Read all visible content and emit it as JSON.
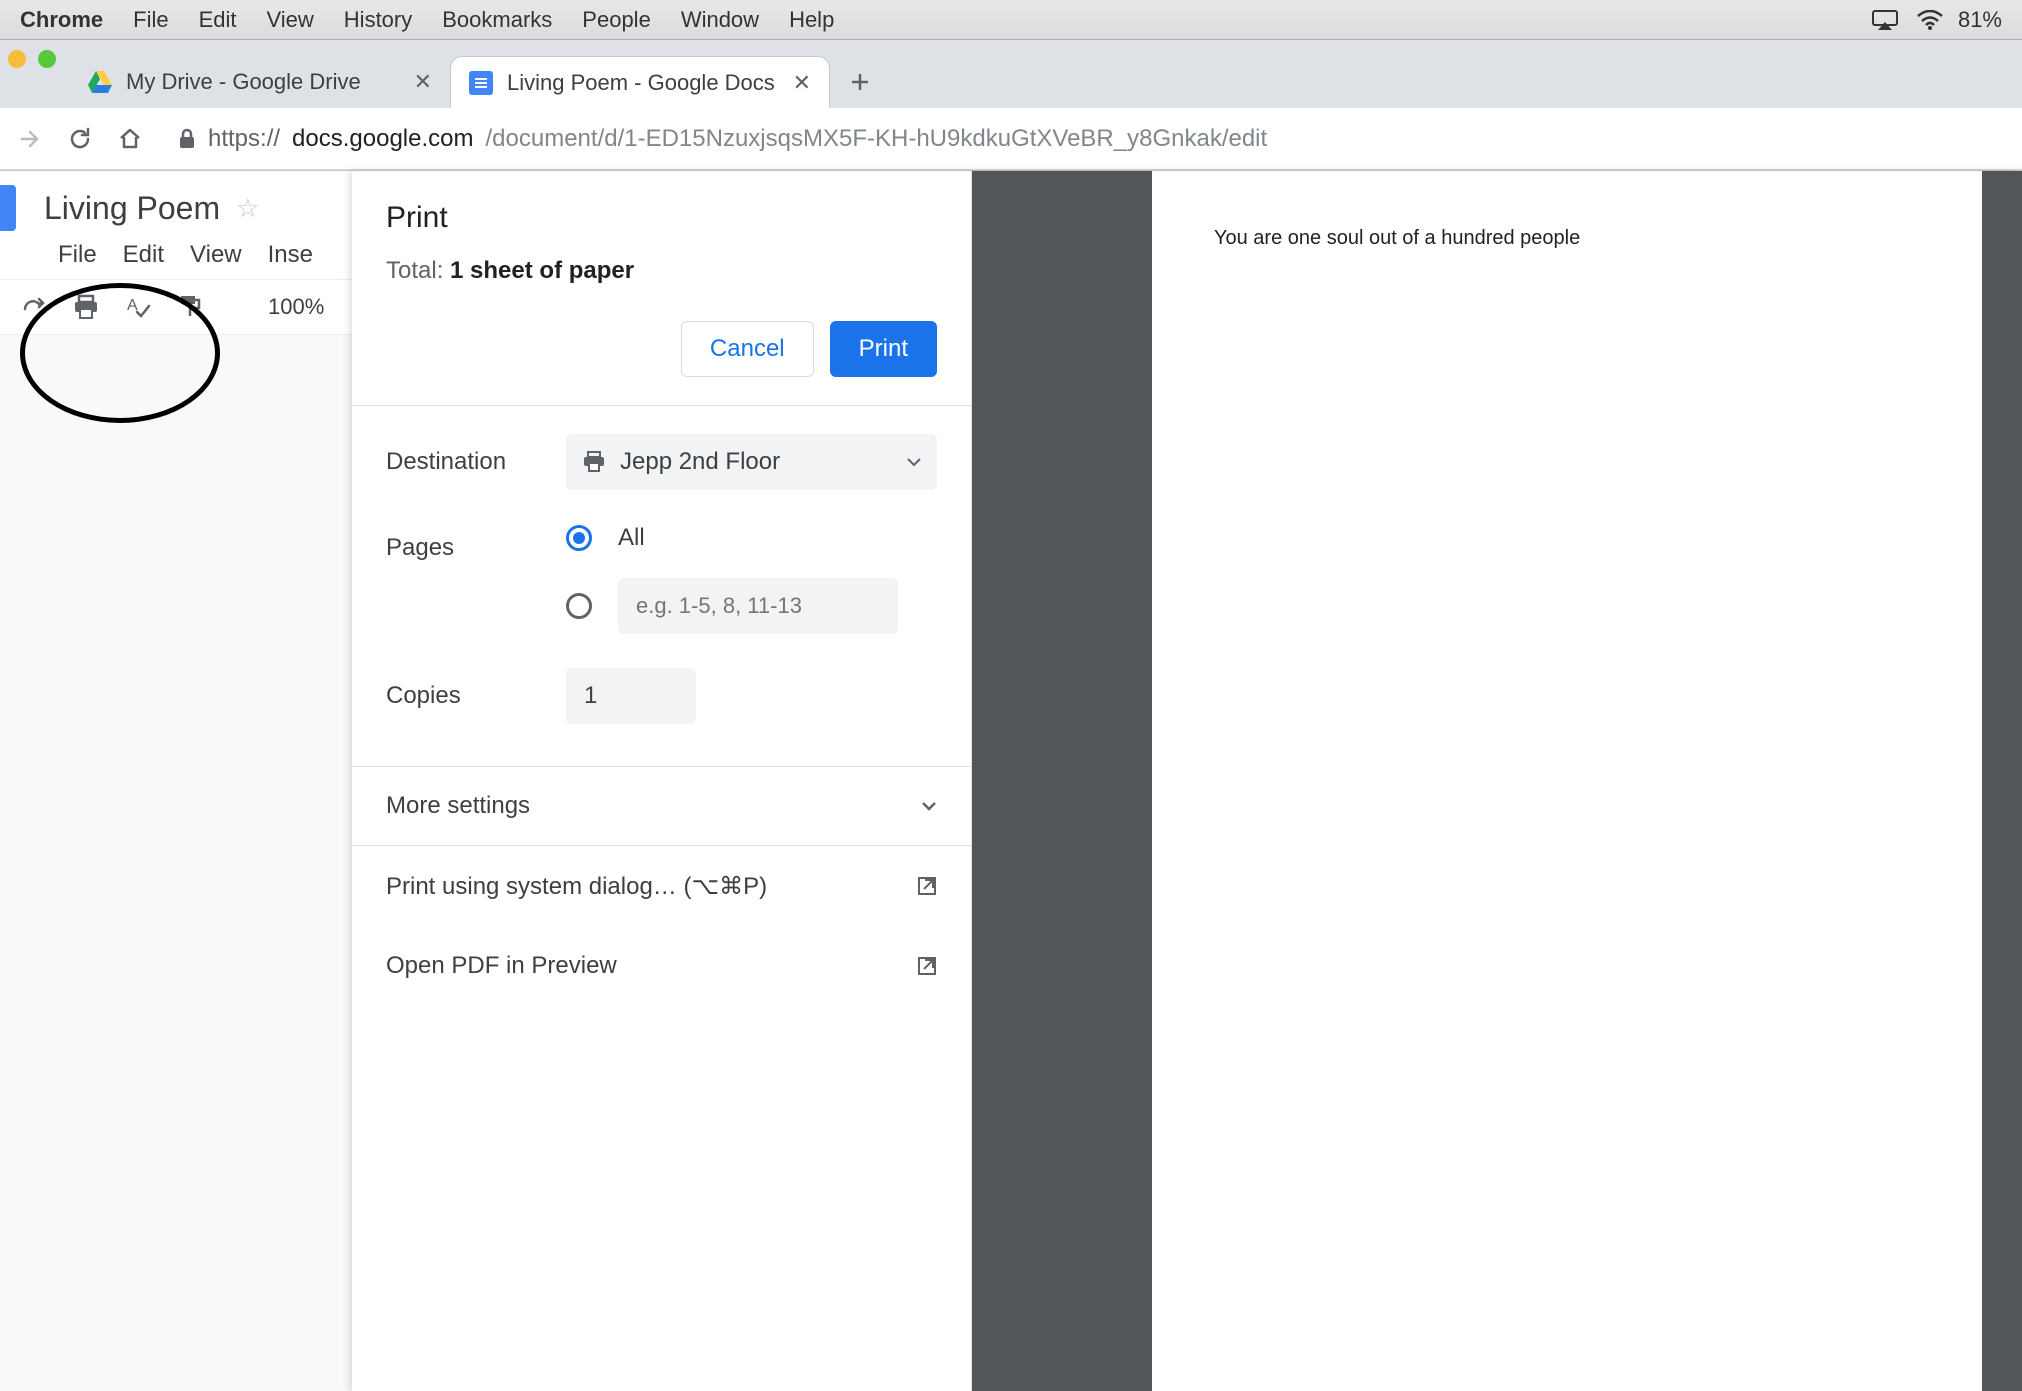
{
  "menubar": {
    "app": "Chrome",
    "items": [
      "File",
      "Edit",
      "View",
      "History",
      "Bookmarks",
      "People",
      "Window",
      "Help"
    ],
    "battery": "81%"
  },
  "tabs": {
    "inactive": {
      "title": "My Drive - Google Drive"
    },
    "active": {
      "title": "Living Poem - Google Docs"
    }
  },
  "omnibox": {
    "scheme": "https://",
    "host": "docs.google.com",
    "path": "/document/d/1-ED15NzuxjsqsMX5F-KH-hU9kdkuGtXVeBR_y8Gnkak/edit"
  },
  "docs": {
    "title": "Living Poem",
    "menus": [
      "File",
      "Edit",
      "View",
      "Inse"
    ],
    "zoom": "100%"
  },
  "print": {
    "title": "Print",
    "total_prefix": "Total: ",
    "total_value": "1 sheet of paper",
    "cancel": "Cancel",
    "print": "Print",
    "destination_label": "Destination",
    "destination_value": "Jepp 2nd Floor",
    "pages_label": "Pages",
    "pages_all": "All",
    "pages_placeholder": "e.g. 1-5, 8, 11-13",
    "copies_label": "Copies",
    "copies_value": "1",
    "more_settings": "More settings",
    "system_dialog": "Print using system dialog… (⌥⌘P)",
    "open_pdf": "Open PDF in Preview"
  },
  "preview_text": "You are one soul out of a hundred people"
}
